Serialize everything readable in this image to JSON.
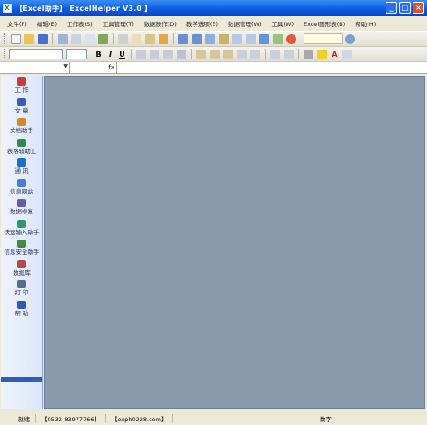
{
  "window": {
    "title": "【Excel助手】 ExcelHelper V3.0 】",
    "controls": [
      "_",
      "□",
      "×"
    ]
  },
  "menu": [
    "文件(F)",
    "编辑(E)",
    "工作表(S)",
    "工具管理(T)",
    "数据操作(D)",
    "教学选项(E)",
    "数据管理(W)",
    "工具(W)",
    "Excel图形表(B)",
    "帮助(H)"
  ],
  "formula_bar": {
    "name_value": "",
    "fx_label": "fx",
    "content": ""
  },
  "sidebar": {
    "items": [
      {
        "label": "工  作",
        "icon": "pencil-icon",
        "color": "#c83c3c"
      },
      {
        "label": "文  章",
        "icon": "document-icon",
        "color": "#3a5fb0"
      },
      {
        "label": "文档助手",
        "icon": "house-icon",
        "color": "#d08a2a"
      },
      {
        "label": "表格辅助工",
        "icon": "table-icon",
        "color": "#2e8a4a"
      },
      {
        "label": "通  讯",
        "icon": "phone-icon",
        "color": "#1f6fc8"
      },
      {
        "label": "信息网站",
        "icon": "globe-icon",
        "color": "#4a7ad8"
      },
      {
        "label": "数据修复",
        "icon": "wrench-icon",
        "color": "#6a5aa8"
      },
      {
        "label": "快速输入助手",
        "icon": "keyboard-icon",
        "color": "#2a9a6a"
      },
      {
        "label": "信息安全助手",
        "icon": "shield-icon",
        "color": "#3f8f3f"
      },
      {
        "label": "数据库",
        "icon": "database-icon",
        "color": "#b04a4a"
      },
      {
        "label": "打  印",
        "icon": "printer-icon",
        "color": "#5a6a8a"
      },
      {
        "label": "帮  助",
        "icon": "help-icon",
        "color": "#2a5ab8"
      }
    ]
  },
  "status": {
    "ready": "就绪",
    "phone": "【0532-83977766】",
    "site": "【exph0228.com】",
    "num": "数字"
  },
  "colors": {
    "workspace": "#8a9aad",
    "titlebar": "#0a58e0"
  }
}
